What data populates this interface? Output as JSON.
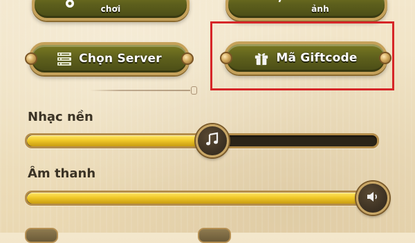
{
  "top_buttons": {
    "left_label": "chơi",
    "right_label": "ảnh"
  },
  "buttons": {
    "choose_server": {
      "label": "Chọn Server",
      "icon": "server-list-icon"
    },
    "giftcode": {
      "label": "Mã Giftcode",
      "icon": "gift-icon"
    }
  },
  "settings": {
    "music": {
      "label": "Nhạc nền",
      "level_fraction": 0.53,
      "icon": "music-note-icon"
    },
    "sound": {
      "label": "Âm thanh",
      "level_fraction": 1.0,
      "icon": "speaker-icon"
    }
  },
  "colors": {
    "highlight": "#d62628",
    "slider_fill": "#f0c928",
    "button_green": "#5d5f1c",
    "gold_border": "#c5a15a"
  }
}
